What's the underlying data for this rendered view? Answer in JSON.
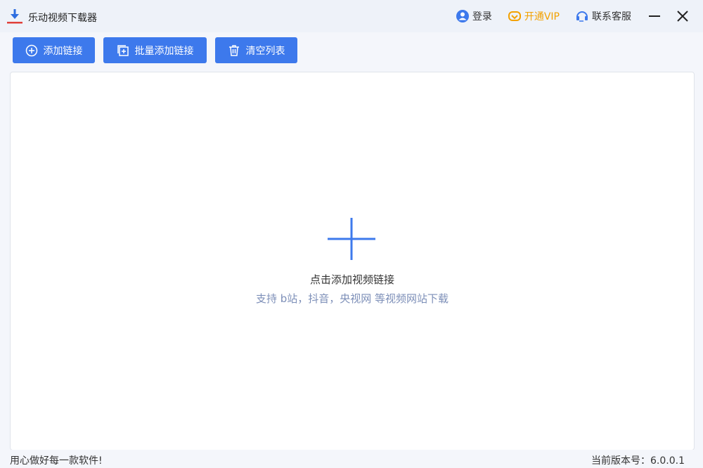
{
  "app": {
    "title": "乐动视频下载器"
  },
  "header": {
    "login_label": "登录",
    "vip_label": "开通VIP",
    "contact_label": "联系客服"
  },
  "toolbar": {
    "add_label": "添加链接",
    "batch_label": "批量添加链接",
    "clear_label": "清空列表"
  },
  "dropzone": {
    "title": "点击添加视频链接",
    "subtitle": "支持 b站，抖音，央视网 等视频网站下载"
  },
  "status": {
    "slogan": "用心做好每一款软件!",
    "version": "当前版本号：6.0.0.1"
  },
  "colors": {
    "accent": "#3d79ec",
    "vip": "#f3a100",
    "hint": "#7d8fb8"
  },
  "icons": [
    "download-logo-icon",
    "user-icon",
    "vip-icon",
    "headset-icon",
    "minimize-icon",
    "close-icon",
    "plus-circle-icon",
    "batch-add-icon",
    "trash-icon",
    "plus-icon"
  ]
}
